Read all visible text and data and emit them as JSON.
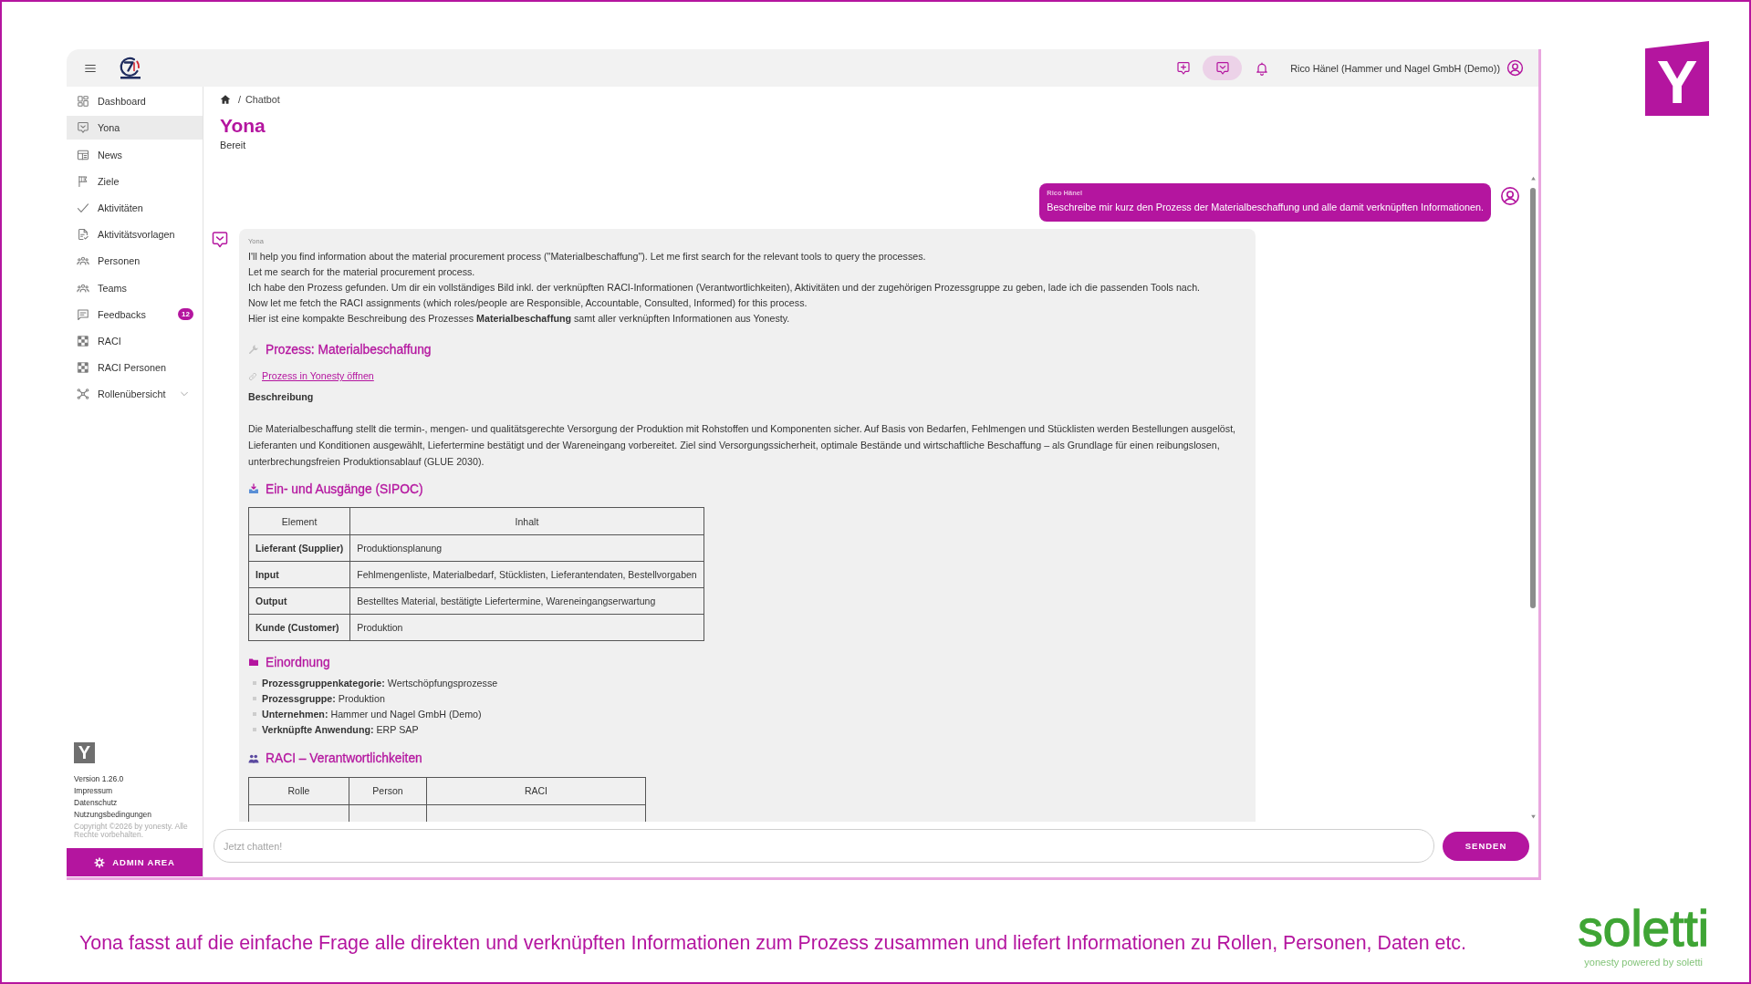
{
  "slide": {
    "corner_logo": "Y",
    "caption": "Yona fasst auf die einfache Frage alle direkten und verknüpften Informationen zum Prozess zusammen und liefert Informationen zu Rollen, Personen, Daten etc.",
    "brand": {
      "name": "soletti",
      "tagline": "yonesty powered by soletti"
    }
  },
  "topbar": {
    "actions": [
      {
        "kind": "newchat",
        "selected": false
      },
      {
        "kind": "chat",
        "selected": true
      },
      {
        "kind": "bell",
        "selected": false
      }
    ],
    "user": "Rico Hänel (Hammer und Nagel GmbH (Demo))"
  },
  "sidebar": {
    "items": [
      {
        "kind": "dashboard",
        "label": "Dashboard",
        "selected": false
      },
      {
        "kind": "chat",
        "label": "Yona",
        "selected": true
      },
      {
        "kind": "news",
        "label": "News",
        "selected": false
      },
      {
        "kind": "flag",
        "label": "Ziele",
        "selected": false
      },
      {
        "kind": "check",
        "label": "Aktivitäten",
        "selected": false
      },
      {
        "kind": "template",
        "label": "Aktivitätsvorlagen",
        "selected": false
      },
      {
        "kind": "people",
        "label": "Personen",
        "selected": false
      },
      {
        "kind": "people",
        "label": "Teams",
        "selected": false
      },
      {
        "kind": "feedback",
        "label": "Feedbacks",
        "selected": false,
        "badge": "12"
      },
      {
        "kind": "grid",
        "label": "RACI",
        "selected": false
      },
      {
        "kind": "grid",
        "label": "RACI Personen",
        "selected": false
      },
      {
        "kind": "network",
        "label": "Rollenübersicht",
        "selected": false,
        "expanded": false
      }
    ],
    "footer": {
      "logo": "Y",
      "version": "Version 1.26.0",
      "links": [
        "Impressum",
        "Datenschutz",
        "Nutzungsbedingungen"
      ],
      "copyright": "Copyright ©2026 by yonesty. Alle Rechte vorbehalten."
    },
    "admin_button": "ADMIN AREA"
  },
  "page": {
    "breadcrumb": {
      "separator": "/",
      "current": "Chatbot"
    },
    "title": "Yona",
    "status": "Bereit"
  },
  "chat": {
    "messages": [
      {
        "kind": "user",
        "author": "Rico Hänel",
        "text": "Beschreibe mir kurz den Prozess der Materialbeschaffung und alle damit verknüpften Informationen."
      },
      {
        "kind": "bot",
        "author": "Yona",
        "blocks": [
          {
            "kind": "lines",
            "lines": [
              "I'll help you find information about the material procurement process (\"Materialbeschaffung\"). Let me first search for the relevant tools to query the processes.",
              "Let me search for the material procurement process.",
              "Ich habe den Prozess gefunden. Um dir ein vollständiges Bild inkl. der verknüpften RACI-Informationen (Verantwortlichkeiten), Aktivitäten und der zugehörigen Prozessgruppe zu geben, lade ich die passenden Tools nach.",
              "Now let me fetch the RACI assignments (which roles/people are Responsible, Accountable, Consulted, Informed) for this process.",
              "Hier ist eine kompakte Beschreibung des Prozesses **Materialbeschaffung** samt aller verknüpften Informationen aus Yonesty."
            ]
          },
          {
            "kind": "heading",
            "text": "Prozess: Materialbeschaffung"
          },
          {
            "kind": "link",
            "text": "Prozess in Yonesty öffnen"
          },
          {
            "kind": "label",
            "text": "Beschreibung"
          },
          {
            "kind": "paragraph",
            "text": "Die Materialbeschaffung stellt die termin-, mengen- und qualitätsgerechte Versorgung der Produktion mit Rohstoffen und Komponenten sicher. Auf Basis von Bedarfen, Fehlmengen und Stücklisten werden Bestellungen ausgelöst, Lieferanten und Konditionen ausgewählt, Liefertermine bestätigt und der Wareneingang vorbereitet. Ziel sind Versorgungssicherheit, optimale Bestände und wirtschaftliche Beschaffung – als Grundlage für einen reibungslosen, unterbrechungsfreien Produktionsablauf (GLUE 2030)."
          },
          {
            "kind": "heading",
            "text": "Ein- und Ausgänge (SIPOC)"
          },
          {
            "kind": "table",
            "columns": [
              "Element",
              "Inhalt"
            ],
            "rows": [
              [
                "Lieferant (Supplier)",
                "Produktionsplanung"
              ],
              [
                "Input",
                "Fehlmengenliste, Materialbedarf, Stücklisten, Lieferantendaten, Bestellvorgaben"
              ],
              [
                "Output",
                "Bestelltes Material, bestätigte Liefertermine, Wareneingangserwartung"
              ],
              [
                "Kunde (Customer)",
                "Produktion"
              ]
            ]
          },
          {
            "kind": "heading",
            "text": "Einordnung"
          },
          {
            "kind": "list",
            "items": [
              "**Prozessgruppenkategorie:** Wertschöpfungsprozesse",
              "**Prozessgruppe:** Produktion",
              "**Unternehmen:** Hammer und Nagel GmbH (Demo)",
              "**Verknüpfte Anwendung:** ERP SAP"
            ]
          },
          {
            "kind": "heading",
            "text": "RACI – Verantwortlichkeiten"
          },
          {
            "kind": "table",
            "columns": [
              "Rolle",
              "Person",
              "RACI"
            ]
          }
        ]
      }
    ]
  },
  "composer": {
    "placeholder": "Jetzt chatten!",
    "send_button": "SENDEN"
  }
}
